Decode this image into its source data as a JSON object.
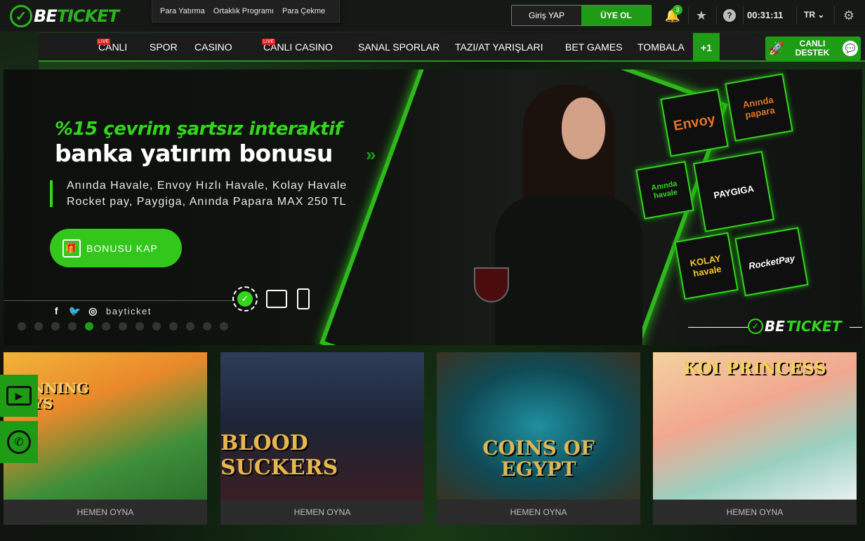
{
  "brand": {
    "prefix": "BE",
    "accent": "TICKET",
    "accent_color": "#2bb31f"
  },
  "quicklinks": [
    "Para Yatırma",
    "Ortaklık Programı",
    "Para Çekme"
  ],
  "auth": {
    "login": "Giriş YAP",
    "register": "ÜYE OL"
  },
  "notifications": {
    "count": "3"
  },
  "clock": "00:31:11",
  "language": "TR",
  "nav": {
    "items": [
      {
        "label": "CANLI",
        "live": "LIVE"
      },
      {
        "label": "SPOR"
      },
      {
        "label": "CASINO"
      },
      {
        "label": "CANLI CASINO",
        "live": "LIVE"
      },
      {
        "label": "SANAL SPORLAR"
      },
      {
        "label": "TAZI/AT YARIŞLARI"
      },
      {
        "label": "BET GAMES"
      },
      {
        "label": "TOMBALA"
      }
    ],
    "more": "+1",
    "support": "CANLI DESTEK"
  },
  "banner": {
    "subtitle": "%15 çevrim şartsız interaktif",
    "title": "banka yatırım bonusu",
    "arrows": "»",
    "line1": "Anında Havale, Envoy Hızlı Havale, Kolay Havale",
    "line2": "Rocket pay, Paygiga, Anında Papara MAX 250 TL",
    "cta": "BONUSU KAP",
    "social_handle": "bayticket",
    "slide_count": 13,
    "active_slide": 5,
    "payment_methods": [
      "Envoy",
      "Anında papara",
      "Anında havale",
      "PAYGIGA",
      "KOLAY havale",
      "RocketPay"
    ]
  },
  "games": [
    {
      "title": "RUNNING WAYS",
      "play": "HEMEN OYNA"
    },
    {
      "title": "BLOOD SUCKERS",
      "play": "HEMEN OYNA"
    },
    {
      "title": "COINS OF EGYPT",
      "play": "HEMEN OYNA"
    },
    {
      "title": "KOI PRINCESS",
      "play": "HEMEN OYNA"
    }
  ]
}
